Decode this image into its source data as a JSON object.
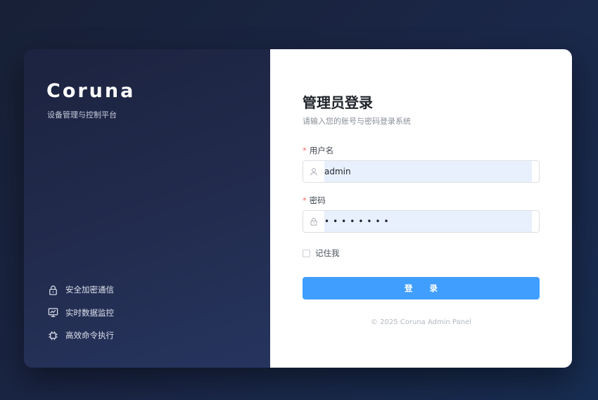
{
  "brand": {
    "name": "Coruna",
    "subtitle": "设备管理与控制平台",
    "features": [
      {
        "icon": "lock-icon",
        "label": "安全加密通信"
      },
      {
        "icon": "monitor-chart-icon",
        "label": "实时数据监控"
      },
      {
        "icon": "chip-icon",
        "label": "高效命令执行"
      }
    ]
  },
  "form": {
    "title": "管理员登录",
    "subtitle": "请输入您的账号与密码登录系统",
    "username": {
      "label": "用户名",
      "value": "admin",
      "icon": "user-icon"
    },
    "password": {
      "label": "密码",
      "value": "••••••••",
      "icon": "lock-icon"
    },
    "remember_label": "记住我",
    "remember_checked": false,
    "submit_label": "登 录",
    "required_mark": "*",
    "footer": "© 2025 Coruna Admin Panel"
  },
  "colors": {
    "accent": "#409eff",
    "autofill_bg": "#e8f0fe",
    "required": "#f56c6c"
  }
}
